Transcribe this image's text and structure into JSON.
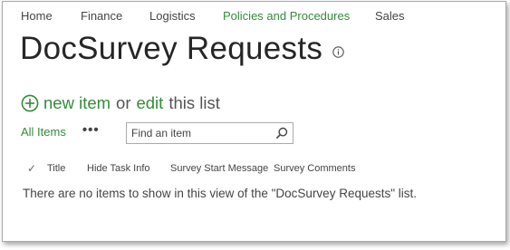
{
  "topnav": {
    "items": [
      {
        "label": "Home"
      },
      {
        "label": "Finance"
      },
      {
        "label": "Logistics"
      },
      {
        "label": "Policies and Procedures"
      },
      {
        "label": "Sales"
      }
    ],
    "active_index": 3
  },
  "page": {
    "title": "DocSurvey Requests",
    "info_icon": "info-icon"
  },
  "actions": {
    "new_item_icon": "plus-circle-icon",
    "new_item_label": "new item",
    "or_label": "or",
    "edit_label": "edit",
    "this_list_label": "this list"
  },
  "views": {
    "current_view": "All Items",
    "more_label": "•••"
  },
  "search": {
    "placeholder": "Find an item",
    "icon": "magnifier-icon"
  },
  "columns": {
    "check_glyph": "✓",
    "headers": [
      "Title",
      "Hide Task Info",
      "Survey Start Message",
      "Survey Comments"
    ]
  },
  "empty_message": "There are no items to show in this view of the \"DocSurvey Requests\" list.",
  "colors": {
    "accent_green": "#338c38",
    "text": "#444444",
    "title": "#262626"
  }
}
